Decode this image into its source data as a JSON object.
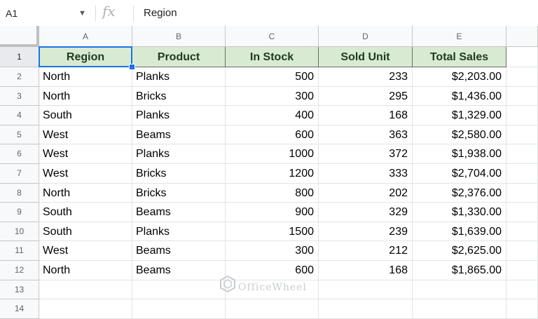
{
  "formula_bar": {
    "cell_ref": "A1",
    "fx_label": "fx",
    "content": "Region"
  },
  "columns": [
    "A",
    "B",
    "C",
    "D",
    "E"
  ],
  "row_numbers": [
    "1",
    "2",
    "3",
    "4",
    "5",
    "6",
    "7",
    "8",
    "9",
    "10",
    "11",
    "12",
    "13",
    "14"
  ],
  "headers": [
    "Region",
    "Product",
    "In Stock",
    "Sold Unit",
    "Total Sales"
  ],
  "rows": [
    [
      "North",
      "Planks",
      "500",
      "233",
      "$2,203.00"
    ],
    [
      "North",
      "Bricks",
      "300",
      "295",
      "$1,436.00"
    ],
    [
      "South",
      "Planks",
      "400",
      "168",
      "$1,329.00"
    ],
    [
      "West",
      "Beams",
      "600",
      "363",
      "$2,580.00"
    ],
    [
      "West",
      "Planks",
      "1000",
      "372",
      "$1,938.00"
    ],
    [
      "West",
      "Bricks",
      "1200",
      "333",
      "$2,704.00"
    ],
    [
      "North",
      "Bricks",
      "800",
      "202",
      "$2,376.00"
    ],
    [
      "South",
      "Beams",
      "900",
      "329",
      "$1,330.00"
    ],
    [
      "South",
      "Planks",
      "1500",
      "239",
      "$1,639.00"
    ],
    [
      "West",
      "Beams",
      "300",
      "212",
      "$2,625.00"
    ],
    [
      "North",
      "Beams",
      "600",
      "168",
      "$1,865.00"
    ]
  ],
  "watermark": "OfficeWheel",
  "colors": {
    "header_fill": "#d9ead3",
    "selection": "#1a73e8"
  }
}
